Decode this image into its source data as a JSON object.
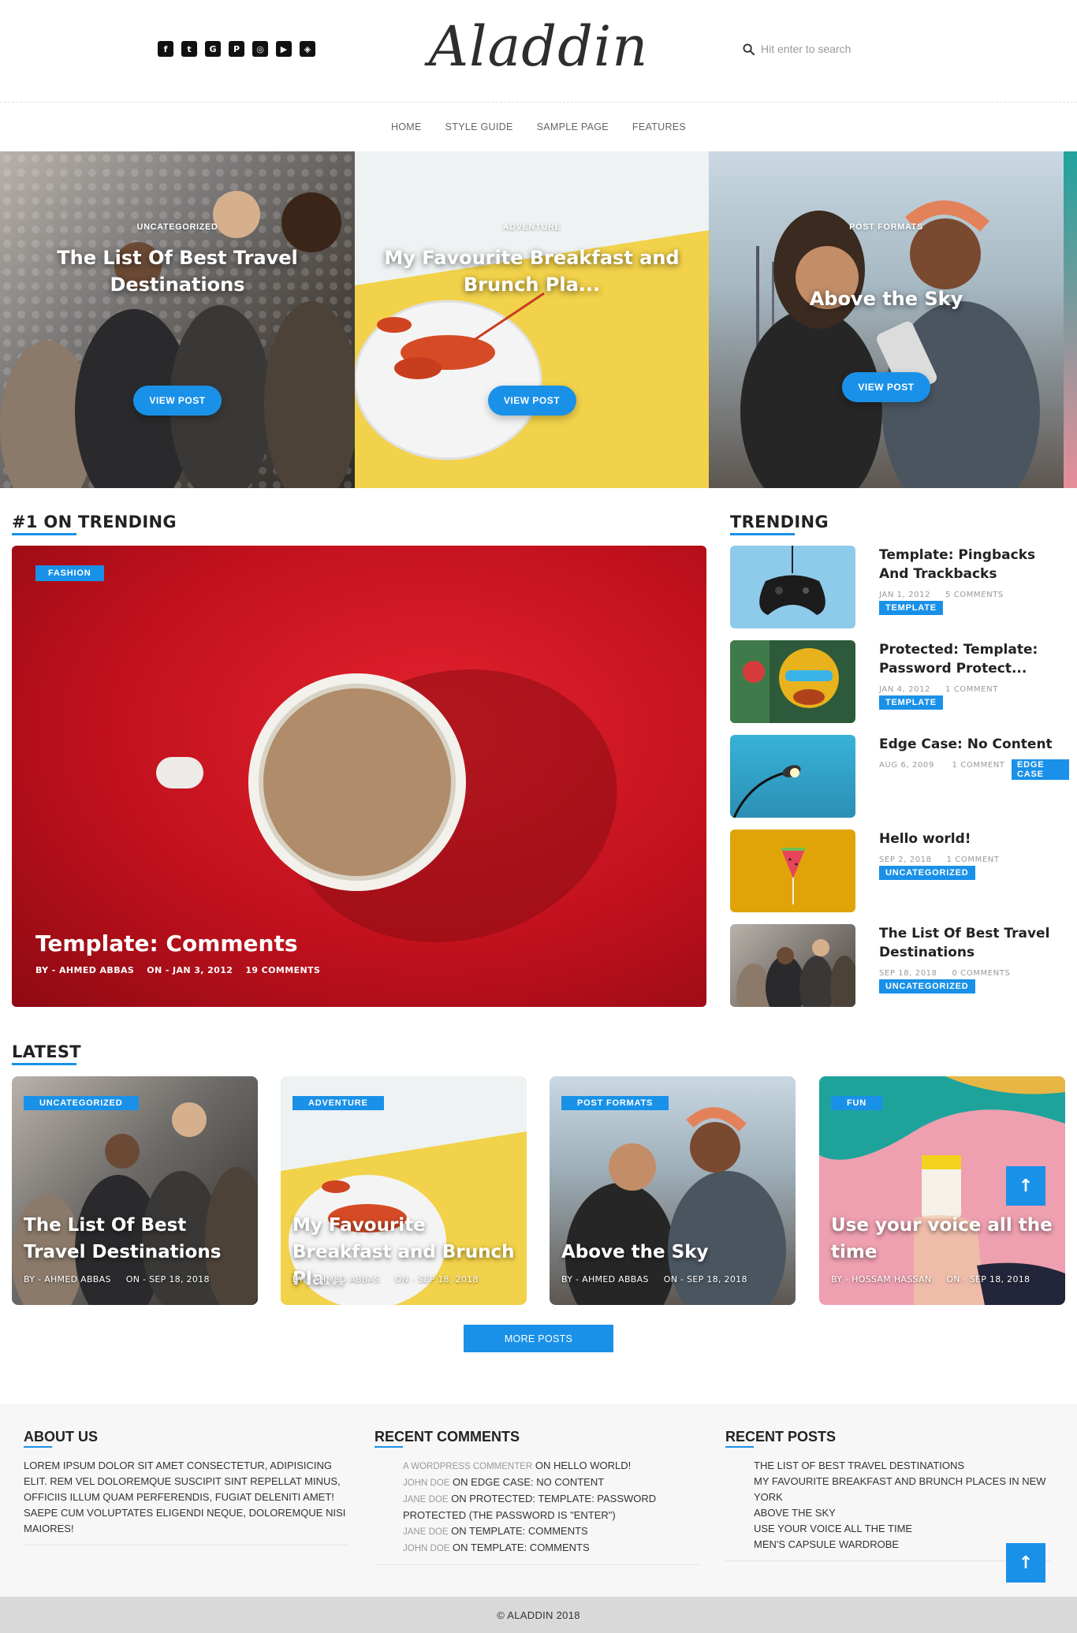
{
  "header": {
    "logo": "Aladdin",
    "social_icons": [
      "facebook-icon",
      "twitter-icon",
      "google-icon",
      "pinterest-icon",
      "instagram-icon",
      "youtube-icon",
      "codepen-icon"
    ],
    "search_placeholder": "Hit enter to search"
  },
  "nav": [
    "HOME",
    "STYLE GUIDE",
    "SAMPLE PAGE",
    "FEATURES"
  ],
  "hero": [
    {
      "category": "UNCATEGORIZED",
      "title": "The List Of Best Travel Destinations",
      "button": "VIEW POST"
    },
    {
      "category": "ADVENTURE",
      "title": "My Favourite Breakfast and Brunch Pla...",
      "button": "VIEW POST"
    },
    {
      "category": "POST FORMATS",
      "title": "Above the Sky",
      "button": "VIEW POST"
    }
  ],
  "trending_main": {
    "heading": "#1 ON TRENDING",
    "tag": "FASHION",
    "title": "Template: Comments",
    "author": "BY - AHMED ABBAS",
    "date": "ON - JAN 3, 2012",
    "comments": "19 COMMENTS"
  },
  "trending": {
    "heading": "TRENDING",
    "items": [
      {
        "title": "Template: Pingbacks And Trackbacks",
        "date": "JAN 1, 2012",
        "comments": "5 COMMENTS",
        "tag": "TEMPLATE"
      },
      {
        "title": "Protected: Template: Password Protect...",
        "date": "JAN 4, 2012",
        "comments": "1 COMMENT",
        "tag": "TEMPLATE"
      },
      {
        "title": "Edge Case: No Content",
        "date": "AUG 6, 2009",
        "comments": "1 COMMENT",
        "tag": "EDGE CASE"
      },
      {
        "title": "Hello world!",
        "date": "SEP 2, 2018",
        "comments": "1 COMMENT",
        "tag": "UNCATEGORIZED"
      },
      {
        "title": "The List Of Best Travel Destinations",
        "date": "SEP 18, 2018",
        "comments": "0 COMMENTS",
        "tag": "UNCATEGORIZED"
      }
    ]
  },
  "latest": {
    "heading": "LATEST",
    "cards": [
      {
        "tag": "UNCATEGORIZED",
        "title": "The List Of Best Travel Destinations",
        "author": "BY - AHMED ABBAS",
        "date": "ON - SEP 18, 2018"
      },
      {
        "tag": "ADVENTURE",
        "title": "My Favourite Breakfast and Brunch Pla...",
        "author": "BY - AHMED ABBAS",
        "date": "ON - SEP 18, 2018"
      },
      {
        "tag": "POST FORMATS",
        "title": "Above the Sky",
        "author": "BY - AHMED ABBAS",
        "date": "ON - SEP 18, 2018"
      },
      {
        "tag": "FUN",
        "title": "Use your voice all the time",
        "author": "BY - HOSSAM HASSAN",
        "date": "ON - SEP 18, 2018"
      }
    ],
    "more_button": "MORE POSTS"
  },
  "footer": {
    "about": {
      "heading": "ABOUT US",
      "text": "LOREM IPSUM DOLOR SIT AMET CONSECTETUR, ADIPISICING ELIT. REM VEL DOLOREMQUE SUSCIPIT SINT REPELLAT MINUS, OFFICIIS ILLUM QUAM PERFERENDIS, FUGIAT DELENITI AMET! SAEPE CUM VOLUPTATES ELIGENDI NEQUE, DOLOREMQUE NISI MAIORES!"
    },
    "recent_comments": {
      "heading": "RECENT COMMENTS",
      "items": [
        {
          "who": "A WORDPRESS COMMENTER",
          "on": "ON HELLO WORLD!"
        },
        {
          "who": "JOHN DOE",
          "on": "ON EDGE CASE: NO CONTENT"
        },
        {
          "who": "JANE DOE",
          "on": "ON PROTECTED: TEMPLATE: PASSWORD PROTECTED (THE PASSWORD IS \"ENTER\")"
        },
        {
          "who": "JANE DOE",
          "on": "ON TEMPLATE: COMMENTS"
        },
        {
          "who": "JOHN DOE",
          "on": "ON TEMPLATE: COMMENTS"
        }
      ]
    },
    "recent_posts": {
      "heading": "RECENT POSTS",
      "items": [
        "THE LIST OF BEST TRAVEL DESTINATIONS",
        "MY FAVOURITE BREAKFAST AND BRUNCH PLACES IN NEW YORK",
        "ABOVE THE SKY",
        "USE YOUR VOICE ALL THE TIME",
        "MEN'S CAPSULE WARDROBE"
      ]
    },
    "copyright": "© ALADDIN 2018"
  },
  "colors": {
    "accent": "#1a91e8",
    "hero_yellow": "#f2d24a",
    "feature_red": "#d0141f"
  },
  "icons": {
    "search": "search-icon",
    "back_to_top": "arrow-up-icon"
  }
}
